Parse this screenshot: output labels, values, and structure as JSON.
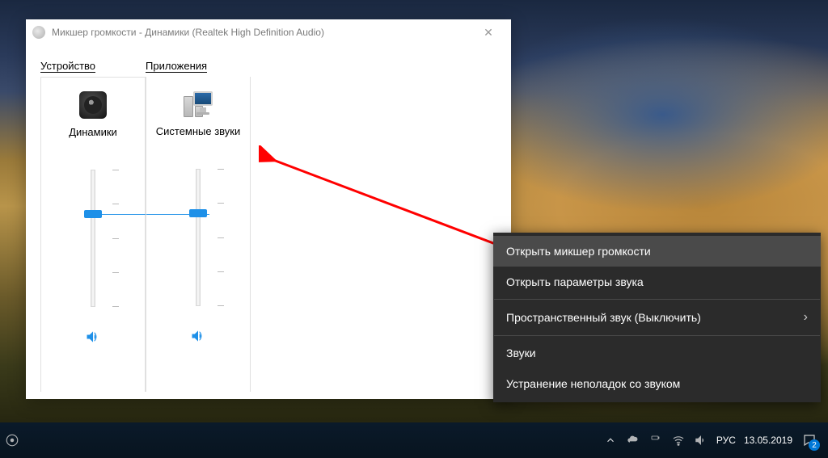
{
  "window": {
    "title": "Микшер громкости - Динамики (Realtek High Definition Audio)"
  },
  "mixer": {
    "device_section_label": "Устройство",
    "apps_section_label": "Приложения",
    "channels": [
      {
        "label": "Динамики",
        "level": 68,
        "muted": false,
        "icon": "speaker"
      },
      {
        "label": "Системные звуки",
        "level": 68,
        "muted": false,
        "icon": "system-sounds"
      }
    ]
  },
  "context_menu": {
    "items": [
      {
        "label": "Открыть микшер громкости",
        "highlighted": true
      },
      {
        "label": "Открыть параметры звука"
      },
      {
        "sep": true
      },
      {
        "label": "Пространственный звук (Выключить)",
        "submenu": true
      },
      {
        "sep": true
      },
      {
        "label": "Звуки"
      },
      {
        "label": "Устранение неполадок со звуком"
      }
    ]
  },
  "taskbar": {
    "lang": "РУС",
    "date": "13.05.2019",
    "notif_count": "2"
  }
}
